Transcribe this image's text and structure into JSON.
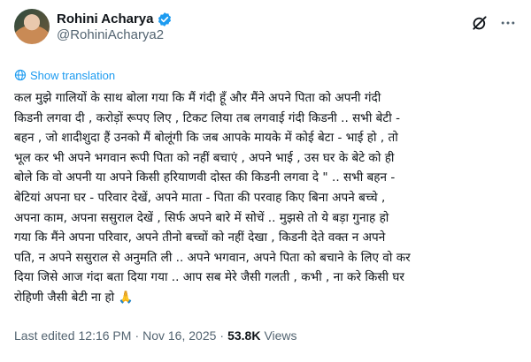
{
  "author": {
    "display_name": "Rohini Acharya",
    "handle": "@RohiniAcharya2"
  },
  "icons": {
    "verified": "verified-badge-icon",
    "grok": "grok-icon",
    "more": "more-options-icon",
    "translate": "globe-icon"
  },
  "colors": {
    "accent": "#1d9bf0",
    "secondary_text": "#536471"
  },
  "show_translation_label": "Show translation",
  "body_lines": [
    "कल मुझे गालियों के साथ बोला गया कि मैं गंदी हूँ और मैंने अपने  पिता को अपनी गंदी",
    "किडनी लगवा दी , करोड़ों रूपए लिए , टिकट लिया तब लगवाई गंदी किडनी .. सभी बेटी -",
    "बहन , जो शादीशुदा हैं उनको मैं बोलूंगी कि जब आपके मायके में कोई बेटा - भाई हो , तो",
    "भूल कर भी अपने भगवान रूपी पिता को नहीं बचाएं , अपने भाई , उस घर के बेटे को ही",
    "बोले कि वो अपनी या अपने किसी हरियाणवी  दोस्त की किडनी लगवा दे \" .. सभी बहन -",
    "बेटियां अपना घर - परिवार देखें, अपने माता - पिता की परवाह किए बिना अपने बच्चे ,",
    "अपना काम, अपना ससुराल देखें , सिर्फ अपने बारे में सोचें ..  मुझसे तो ये बड़ा गुनाह हो",
    "गया कि मैंने अपना परिवार, अपने तीनो बच्चों को नहीं देखा , किडनी देते वक्त न अपने",
    "पति, न अपने ससुराल से अनुमति ली .. अपने भगवान, अपने पिता को बचाने के लिए वो कर",
    "दिया जिसे आज गंदा बता दिया गया .. आप सब मेरे जैसी गलती , कभी , ना करे किसी घर",
    "रोहिणी जैसी बेटी ना हो 🙏"
  ],
  "meta": {
    "edited_label": "Last edited",
    "time": "12:16 PM",
    "separator": "·",
    "date": "Nov 16, 2025",
    "views_count": "53.8K",
    "views_label": "Views"
  }
}
